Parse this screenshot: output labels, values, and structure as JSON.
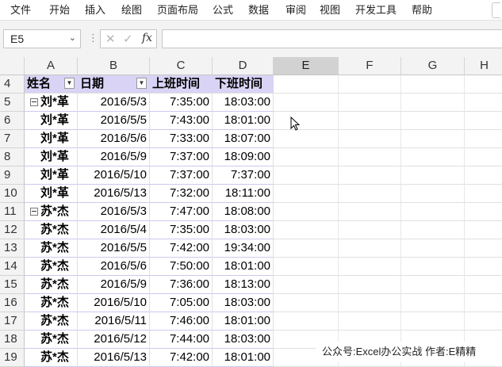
{
  "ribbon": {
    "tabs": [
      "文件",
      "开始",
      "插入",
      "绘图",
      "页面布局",
      "公式",
      "数据",
      "审阅",
      "视图",
      "开发工具",
      "帮助"
    ]
  },
  "formula_bar": {
    "name_box": "E5",
    "name_box_dropdown_icon": "chevron-down-icon",
    "separator_icon": "vertical-dots-icon",
    "cancel_icon": "cross-icon",
    "enter_icon": "check-icon",
    "fx_label": "fx",
    "formula": ""
  },
  "columns": [
    "A",
    "B",
    "C",
    "D",
    "E",
    "F",
    "G",
    "H"
  ],
  "selected_column": "E",
  "header_row": {
    "row_num": "4",
    "cells": [
      "姓名",
      "日期",
      "上班时间",
      "下班时间"
    ]
  },
  "rows": [
    {
      "row_num": "5",
      "name": "刘*革",
      "date": "2016/5/3",
      "start": "7:35:00",
      "end": "18:03:00",
      "group_start": true
    },
    {
      "row_num": "6",
      "name": "刘*革",
      "date": "2016/5/5",
      "start": "7:43:00",
      "end": "18:01:00",
      "group_start": false
    },
    {
      "row_num": "7",
      "name": "刘*革",
      "date": "2016/5/6",
      "start": "7:33:00",
      "end": "18:07:00",
      "group_start": false
    },
    {
      "row_num": "8",
      "name": "刘*革",
      "date": "2016/5/9",
      "start": "7:37:00",
      "end": "18:09:00",
      "group_start": false
    },
    {
      "row_num": "9",
      "name": "刘*革",
      "date": "2016/5/10",
      "start": "7:37:00",
      "end": "7:37:00",
      "group_start": false
    },
    {
      "row_num": "10",
      "name": "刘*革",
      "date": "2016/5/13",
      "start": "7:32:00",
      "end": "18:11:00",
      "group_start": false
    },
    {
      "row_num": "11",
      "name": "苏*杰",
      "date": "2016/5/3",
      "start": "7:47:00",
      "end": "18:08:00",
      "group_start": true
    },
    {
      "row_num": "12",
      "name": "苏*杰",
      "date": "2016/5/4",
      "start": "7:35:00",
      "end": "18:03:00",
      "group_start": false
    },
    {
      "row_num": "13",
      "name": "苏*杰",
      "date": "2016/5/5",
      "start": "7:42:00",
      "end": "19:34:00",
      "group_start": false
    },
    {
      "row_num": "14",
      "name": "苏*杰",
      "date": "2016/5/6",
      "start": "7:50:00",
      "end": "18:01:00",
      "group_start": false
    },
    {
      "row_num": "15",
      "name": "苏*杰",
      "date": "2016/5/9",
      "start": "7:36:00",
      "end": "18:13:00",
      "group_start": false
    },
    {
      "row_num": "16",
      "name": "苏*杰",
      "date": "2016/5/10",
      "start": "7:05:00",
      "end": "18:03:00",
      "group_start": false
    },
    {
      "row_num": "17",
      "name": "苏*杰",
      "date": "2016/5/11",
      "start": "7:46:00",
      "end": "18:01:00",
      "group_start": false
    },
    {
      "row_num": "18",
      "name": "苏*杰",
      "date": "2016/5/12",
      "start": "7:44:00",
      "end": "18:03:00",
      "group_start": false
    },
    {
      "row_num": "19",
      "name": "苏*杰",
      "date": "2016/5/13",
      "start": "7:42:00",
      "end": "18:01:00",
      "group_start": false
    }
  ],
  "watermark": "公众号:Excel办公实战 作者:E精精",
  "colors": {
    "header_fill": "#d9d3f5",
    "selected_col_header": "#d2d2d2"
  }
}
